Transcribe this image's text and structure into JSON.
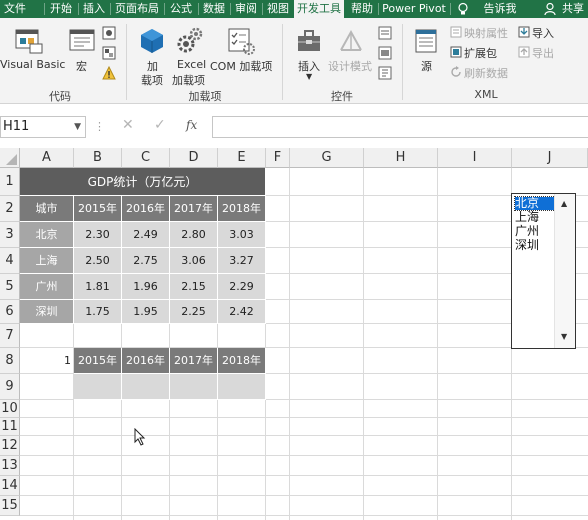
{
  "tabs": [
    {
      "label": "文件",
      "active": false
    },
    {
      "label": "开始",
      "active": false
    },
    {
      "label": "插入",
      "active": false
    },
    {
      "label": "页面布局",
      "active": false
    },
    {
      "label": "公式",
      "active": false
    },
    {
      "label": "数据",
      "active": false
    },
    {
      "label": "审阅",
      "active": false
    },
    {
      "label": "视图",
      "active": false
    },
    {
      "label": "开发工具",
      "active": true
    },
    {
      "label": "帮助",
      "active": false
    },
    {
      "label": "Power Pivot",
      "active": false
    }
  ],
  "tell_me": "告诉我",
  "share": "共享",
  "ribbon": {
    "code": {
      "visual_basic": "Visual Basic",
      "macro": "宏",
      "group": "代码"
    },
    "addins": {
      "addin_line1": "加",
      "addin_line2": "载项",
      "excel_line1": "Excel",
      "excel_line2": "加载项",
      "com": "COM 加载项",
      "group": "加载项"
    },
    "controls": {
      "insert": "插入",
      "design_mode": "设计模式",
      "group": "控件"
    },
    "xml": {
      "source": "源",
      "map_props": "映射属性",
      "expansion": "扩展包",
      "refresh": "刷新数据",
      "import": "导入",
      "export": "导出",
      "group": "XML"
    }
  },
  "formula_bar": {
    "name_box": "H11",
    "fx": "fx",
    "formula": ""
  },
  "sheet": {
    "columns": [
      "A",
      "B",
      "C",
      "D",
      "E",
      "F",
      "G",
      "H",
      "I",
      "J"
    ],
    "rows": [
      "1",
      "2",
      "3",
      "4",
      "5",
      "6",
      "7",
      "8",
      "9",
      "10",
      "11",
      "12",
      "13",
      "14",
      "15"
    ],
    "title": "GDP统计（万亿元）",
    "header": [
      "城市",
      "2015年",
      "2016年",
      "2017年",
      "2018年"
    ],
    "data": [
      {
        "city": "北京",
        "v": [
          "2.30",
          "2.49",
          "2.80",
          "3.03"
        ]
      },
      {
        "city": "上海",
        "v": [
          "2.50",
          "2.75",
          "3.06",
          "3.27"
        ]
      },
      {
        "city": "广州",
        "v": [
          "1.81",
          "1.96",
          "2.15",
          "2.29"
        ]
      },
      {
        "city": "深圳",
        "v": [
          "1.75",
          "1.95",
          "2.25",
          "2.42"
        ]
      }
    ],
    "linked_index": "1",
    "row8_header": [
      "2015年",
      "2016年",
      "2017年",
      "2018年"
    ]
  },
  "listbox": {
    "items": [
      "北京",
      "上海",
      "广州",
      "深圳"
    ],
    "selected_index": 0
  },
  "colors": {
    "brand": "#217346",
    "title_fill": "#5d5d5d",
    "header_fill": "#7a7a7a",
    "city_fill": "#a6a6a6",
    "value_fill": "#d9d9d9",
    "selection": "#0f6fd6"
  }
}
